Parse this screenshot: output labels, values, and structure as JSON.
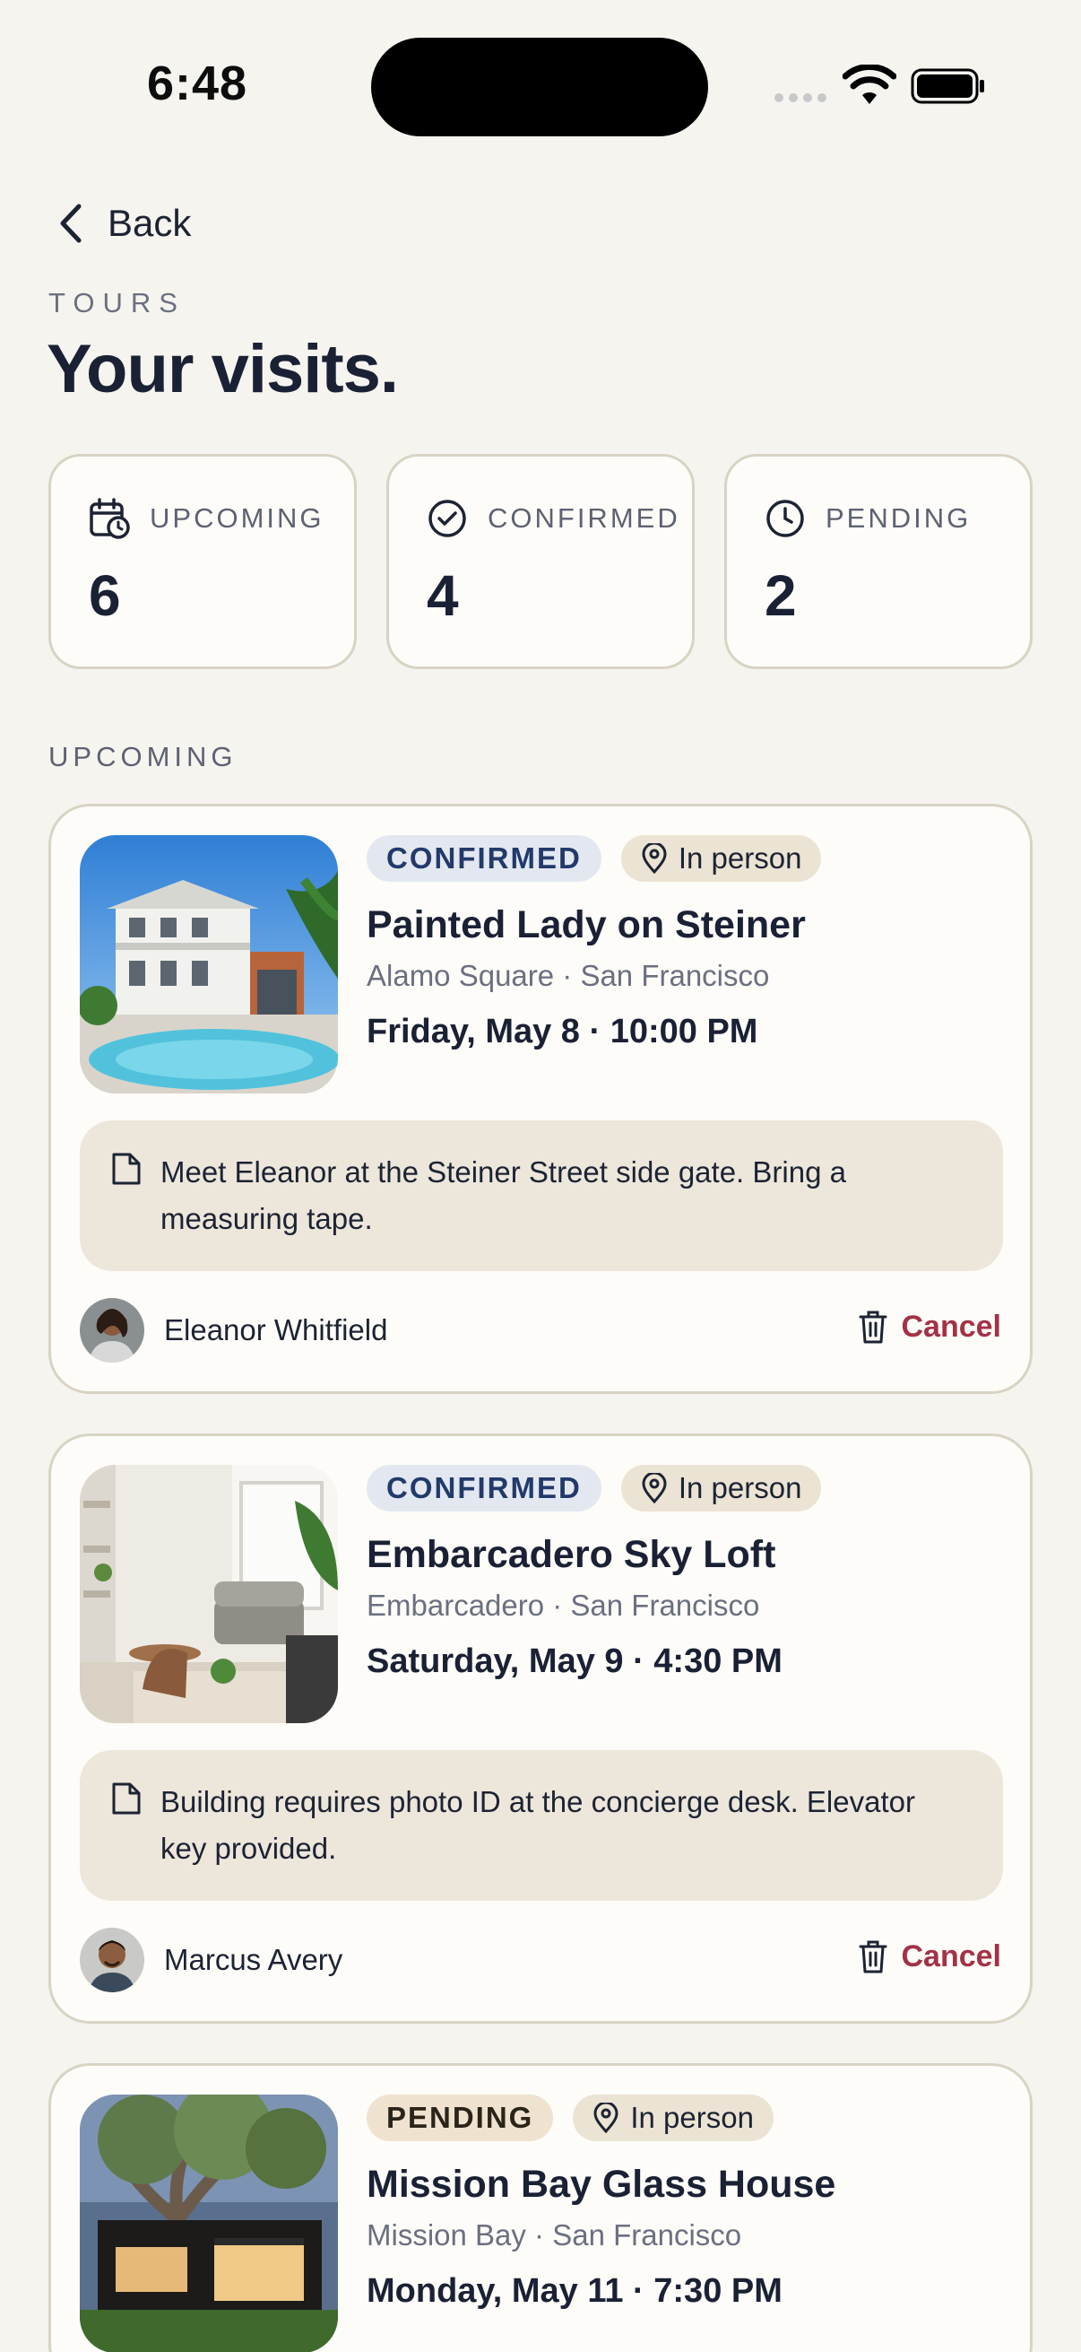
{
  "status_bar": {
    "time": "6:48"
  },
  "header": {
    "back_label": "Back",
    "eyebrow": "TOURS",
    "title": "Your visits."
  },
  "stats": [
    {
      "label": "UPCOMING",
      "value": "6",
      "icon": "calendar-clock-icon"
    },
    {
      "label": "CONFIRMED",
      "value": "4",
      "icon": "check-circle-icon"
    },
    {
      "label": "PENDING",
      "value": "2",
      "icon": "clock-icon"
    }
  ],
  "section_label": "UPCOMING",
  "visits": [
    {
      "status": "CONFIRMED",
      "mode": "In person",
      "title": "Painted Lady on Steiner",
      "location": "Alamo Square · San Francisco",
      "datetime": "Friday, May 8 · 10:00 PM",
      "note": "Meet Eleanor at the Steiner Street side gate. Bring a measuring tape.",
      "host": "Eleanor Whitfield",
      "cancel_label": "Cancel"
    },
    {
      "status": "CONFIRMED",
      "mode": "In person",
      "title": "Embarcadero Sky Loft",
      "location": "Embarcadero · San Francisco",
      "datetime": "Saturday, May 9 · 4:30 PM",
      "note": "Building requires photo ID at the concierge desk. Elevator key provided.",
      "host": "Marcus Avery",
      "cancel_label": "Cancel"
    },
    {
      "status": "PENDING",
      "mode": "In person",
      "title": "Mission Bay Glass House",
      "location": "Mission Bay · San Francisco",
      "datetime": "Monday, May 11 · 7:30 PM"
    }
  ],
  "colors": {
    "background": "#f6f4ef",
    "card": "#fdfcf8",
    "confirmed_badge_text": "#223a6b",
    "cancel": "#a33246"
  }
}
